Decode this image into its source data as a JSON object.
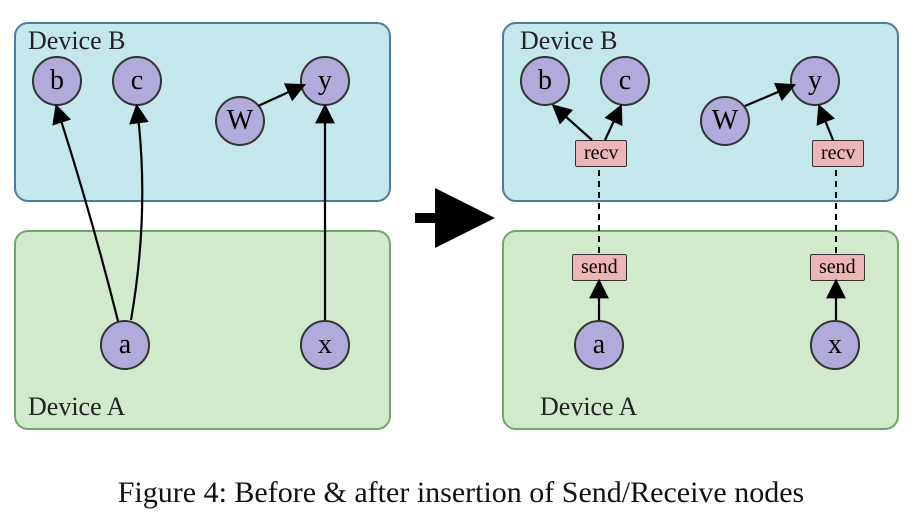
{
  "caption": "Figure 4: Before & after insertion of Send/Receive nodes",
  "left": {
    "deviceB": {
      "label": "Device B",
      "color": "#c4e7ec",
      "border": "#4c7ca3"
    },
    "deviceA": {
      "label": "Device A",
      "color": "#d1eacc",
      "border": "#6fa86c"
    },
    "nodes": {
      "b": "b",
      "c": "c",
      "W": "W",
      "y": "y",
      "a": "a",
      "x": "x"
    }
  },
  "right": {
    "deviceB": {
      "label": "Device B",
      "color": "#c4e7ec",
      "border": "#4c7ca3"
    },
    "deviceA": {
      "label": "Device A",
      "color": "#d1eacc",
      "border": "#6fa86c"
    },
    "nodes": {
      "b": "b",
      "c": "c",
      "W": "W",
      "y": "y",
      "a": "a",
      "x": "x"
    },
    "ops": {
      "recv": "recv",
      "send": "send"
    }
  }
}
